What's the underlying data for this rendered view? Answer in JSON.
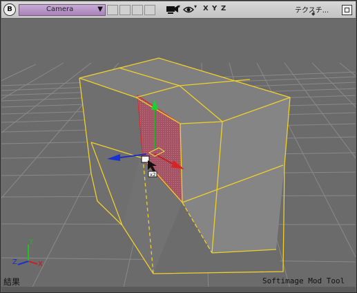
{
  "toolbar": {
    "b_button": "B",
    "camera_label": "Camera",
    "dropdown_arrow": "▼",
    "axes": {
      "x": "X",
      "y": "Y",
      "z": "Z"
    },
    "texture_label": "テクスチ...",
    "texture_arrow": "◆",
    "icons": [
      "camera-icon",
      "eye-icon",
      "maximize-icon"
    ]
  },
  "viewport": {
    "axis_gizmo": {
      "y": "Y",
      "x": "X",
      "z": "Z"
    },
    "cursor_badge": "x2"
  },
  "status": {
    "left": "結果",
    "right": "Softimage Mod Tool"
  },
  "colors": {
    "wire": "#f0d12a",
    "face": "#777777",
    "selected_face": "#9b4a5a",
    "camera_select": "#b593c5"
  }
}
